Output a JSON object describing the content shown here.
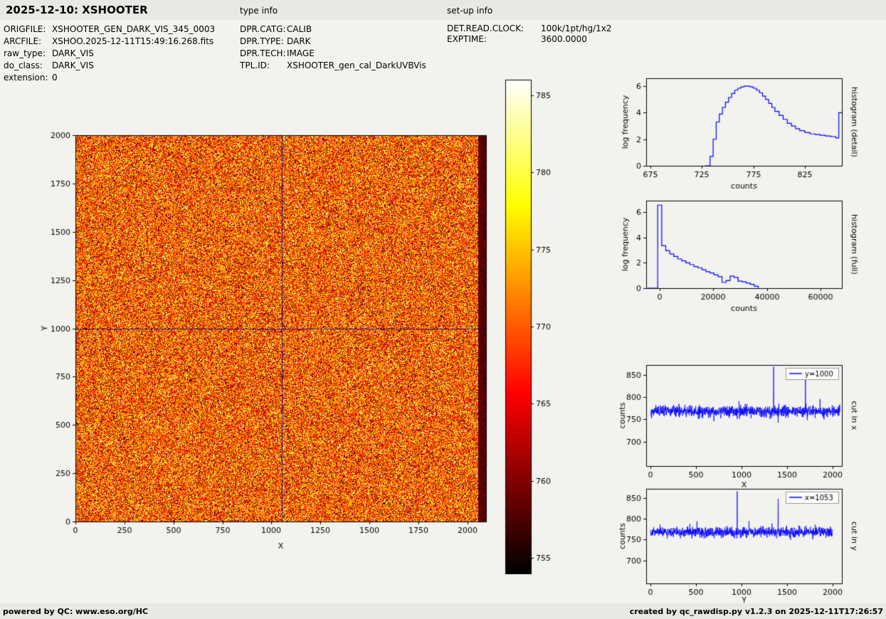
{
  "header": {
    "title": "2025-12-10: XSHOOTER",
    "type_info_label": "type info",
    "setup_info_label": "set-up info"
  },
  "metadata": {
    "left": [
      {
        "label": "ORIGFILE:",
        "value": "XSHOOTER_GEN_DARK_VIS_345_0003"
      },
      {
        "label": "ARCFILE:",
        "value": "XSHOO.2025-12-11T15:49:16.268.fits"
      },
      {
        "label": "raw_type:",
        "value": "DARK_VIS"
      },
      {
        "label": "do_class:",
        "value": "DARK_VIS"
      },
      {
        "label": "extension:",
        "value": "0"
      }
    ],
    "middle": [
      {
        "label": "DPR.CATG:",
        "value": "CALIB"
      },
      {
        "label": "DPR.TYPE:",
        "value": "DARK"
      },
      {
        "label": "DPR.TECH:",
        "value": "IMAGE"
      },
      {
        "label": "TPL.ID:",
        "value": "XSHOOTER_gen_cal_DarkUVBVis"
      }
    ],
    "right": [
      {
        "label": "DET.READ.CLOCK:",
        "value": "100k/1pt/hg/1x2"
      },
      {
        "label": "EXPTIME:",
        "value": "3600.0000"
      }
    ]
  },
  "footer": {
    "left": "powered by QC: www.eso.org/HC",
    "right": "created by qc_rawdisp.py v1.2.3 on 2025-12-11T17:26:57"
  },
  "chart_data": [
    {
      "id": "main_image",
      "type": "heatmap",
      "description": "Raw dark calibration frame, per-pixel noise displayed with hot colormap, dark overscan strip at right edge, blue crosshair cut lines",
      "xlabel": "X",
      "ylabel": "Y",
      "xlim": [
        0,
        2095
      ],
      "ylim": [
        0,
        2000
      ],
      "xticks": [
        0,
        250,
        500,
        750,
        1000,
        1250,
        1500,
        1750,
        2000
      ],
      "yticks": [
        0,
        250,
        500,
        750,
        1000,
        1250,
        1500,
        1750,
        2000
      ],
      "value_mean": 770,
      "value_sigma": 7,
      "colormap": "hot",
      "colormap_range": [
        754,
        786
      ],
      "dark_right_edge_x": 2052,
      "crosshair_x": 1053,
      "crosshair_y": 1000,
      "crosshair_color": "#00008b",
      "seed": 42
    },
    {
      "id": "colorbar",
      "type": "colorbar",
      "colormap": "hot",
      "range": [
        754,
        786
      ],
      "ticks": [
        755,
        760,
        765,
        770,
        775,
        780,
        785
      ]
    },
    {
      "id": "histogram_detail",
      "type": "line",
      "right_label": "histogram (detail)",
      "xlabel": "counts",
      "ylabel": "log frequency",
      "xlim": [
        671,
        861
      ],
      "ylim": [
        0,
        6.6
      ],
      "xticks": [
        675,
        725,
        775,
        825
      ],
      "yticks": [
        0,
        2,
        4,
        6
      ],
      "line_color": "#0000ff",
      "step_x": [
        728,
        733,
        736,
        739,
        742,
        745,
        748,
        751,
        754,
        757,
        760,
        763,
        766,
        769,
        772,
        775,
        778,
        781,
        784,
        787,
        790,
        793,
        796,
        800,
        804,
        808,
        812,
        816,
        820,
        825,
        830,
        835,
        840,
        845,
        850,
        855,
        858,
        861
      ],
      "step_y": [
        0,
        0.7,
        2.0,
        3.3,
        3.9,
        4.4,
        4.8,
        5.15,
        5.45,
        5.7,
        5.85,
        5.95,
        6.0,
        6.0,
        5.95,
        5.85,
        5.7,
        5.5,
        5.25,
        5.0,
        4.7,
        4.4,
        4.1,
        3.8,
        3.5,
        3.2,
        3.0,
        2.8,
        2.65,
        2.5,
        2.4,
        2.35,
        2.3,
        2.25,
        2.2,
        2.1,
        4.0,
        4.0
      ]
    },
    {
      "id": "histogram_full",
      "type": "line",
      "right_label": "histogram (full)",
      "xlabel": "counts",
      "ylabel": "log frequency",
      "xlim": [
        -5000,
        68000
      ],
      "ylim": [
        0,
        6.9
      ],
      "xticks": [
        0,
        20000,
        40000,
        60000
      ],
      "yticks": [
        0,
        2,
        4,
        6
      ],
      "line_color": "#0000ff",
      "step_x": [
        -4500,
        -700,
        800,
        2300,
        3800,
        5300,
        6800,
        8300,
        9800,
        11300,
        12800,
        14300,
        15800,
        17300,
        18800,
        20300,
        21800,
        23300,
        24800,
        26300,
        27800,
        29300,
        30800,
        32300,
        33800,
        35300,
        36800
      ],
      "step_y": [
        0,
        6.55,
        3.35,
        2.95,
        2.7,
        2.5,
        2.3,
        2.15,
        2.0,
        1.85,
        1.7,
        1.6,
        1.45,
        1.3,
        1.2,
        1.05,
        0.9,
        0.45,
        0.6,
        0.95,
        0.85,
        0.55,
        0.5,
        0.4,
        0.3,
        0.15,
        0
      ]
    },
    {
      "id": "cut_in_x",
      "type": "line",
      "legend": "y=1000",
      "right_label": "cut in x",
      "xlabel": "X",
      "ylabel": "counts",
      "xlim": [
        -50,
        2100
      ],
      "ylim": [
        645,
        872
      ],
      "xticks": [
        0,
        500,
        1000,
        1500,
        2000
      ],
      "yticks": [
        700,
        750,
        800,
        850
      ],
      "line_color": "#0000ff",
      "baseline": 768,
      "noise_sigma": 6,
      "n_points": 2080,
      "spikes": [
        {
          "x": 1350,
          "value": 868
        },
        {
          "x": 1700,
          "value": 843
        }
      ],
      "seed": 1201
    },
    {
      "id": "cut_in_y",
      "type": "line",
      "legend": "x=1053",
      "right_label": "cut in y",
      "xlabel": "Y",
      "ylabel": "counts",
      "xlim": [
        -50,
        2100
      ],
      "ylim": [
        645,
        872
      ],
      "xticks": [
        0,
        500,
        1000,
        1500,
        2000
      ],
      "yticks": [
        700,
        750,
        800,
        850
      ],
      "line_color": "#0000ff",
      "baseline": 768,
      "noise_sigma": 6,
      "n_points": 2000,
      "spikes": [
        {
          "x": 950,
          "value": 866
        },
        {
          "x": 1400,
          "value": 848
        }
      ],
      "seed": 777
    }
  ]
}
